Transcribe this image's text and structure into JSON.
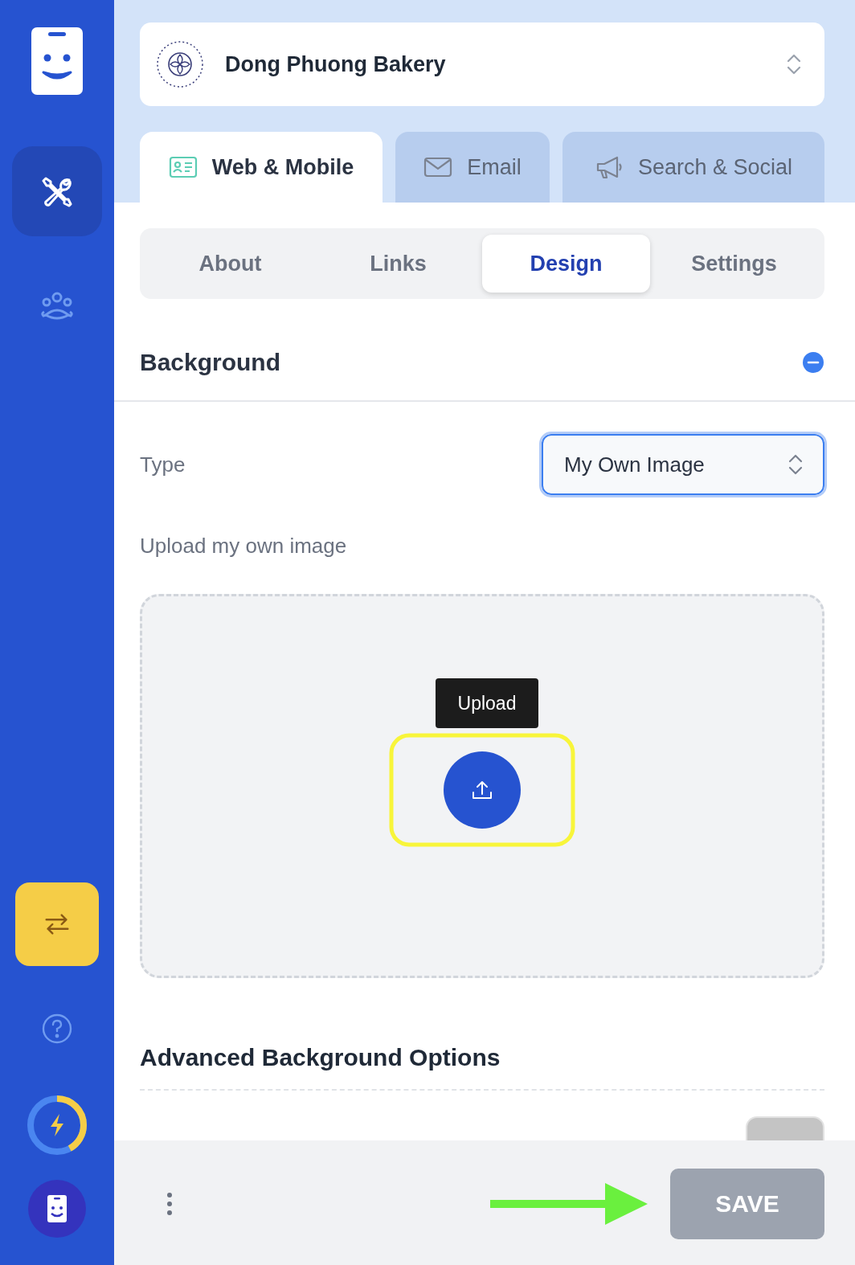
{
  "sidebar": {
    "nav": [
      {
        "kind": "tools",
        "selected": true
      },
      {
        "kind": "people",
        "selected": false
      }
    ],
    "usage_meter": {
      "level": 0.42
    }
  },
  "business": {
    "name": "Dong Phuong Bakery"
  },
  "channel_tabs": [
    {
      "kind": "card",
      "label": "Web & Mobile",
      "selected": true
    },
    {
      "kind": "mail",
      "label": "Email",
      "selected": false
    },
    {
      "kind": "megaphone",
      "label": "Search & Social",
      "selected": false
    }
  ],
  "section_tabs": [
    {
      "label": "About",
      "selected": false
    },
    {
      "label": "Links",
      "selected": false
    },
    {
      "label": "Design",
      "selected": true
    },
    {
      "label": "Settings",
      "selected": false
    }
  ],
  "section": {
    "title": "Background",
    "expanded": true
  },
  "type_field": {
    "label": "Type",
    "value": "My Own Image"
  },
  "upload": {
    "label": "Upload my own image",
    "tooltip": "Upload"
  },
  "advanced": {
    "title": "Advanced Background Options"
  },
  "footer": {
    "save": "SAVE",
    "save_disabled": true
  }
}
